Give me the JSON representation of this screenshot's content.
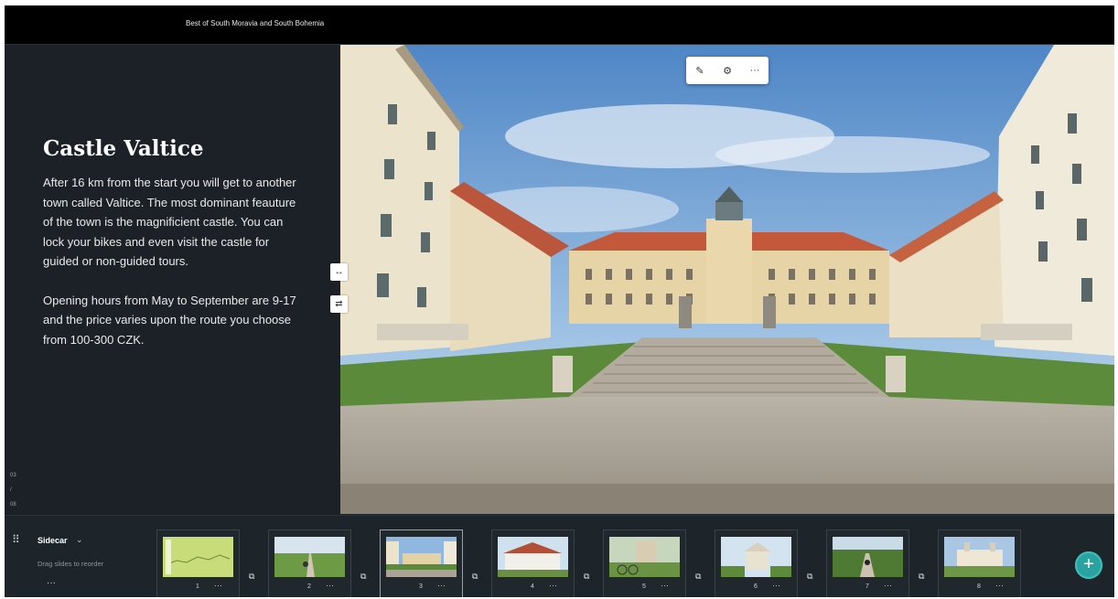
{
  "header": {
    "story_title": "Best of South Moravia and South Bohemia"
  },
  "slide": {
    "heading": "Castle Valtice",
    "paragraph1": "After 16 km from the start you will get to another town called Valtice. The most dominant feauture of the town is the magnificient castle. You can lock your bikes and even visit the castle for guided or non-guided tours.",
    "paragraph2": "Opening hours from May to September are 9-17 and the price varies upon the route you choose from 100-300 CZK.",
    "counter_current": "03",
    "counter_sep": "/",
    "counter_total": "08"
  },
  "side_buttons": {
    "swap_width_icon": "↔",
    "swap_sides_icon": "⇄"
  },
  "media_toolbar": {
    "edit_icon": "✎",
    "settings_icon": "⚙",
    "more_icon": "···"
  },
  "bottom_bar": {
    "label": "Sidecar",
    "chevron": "⌄",
    "hint": "Drag slides to reorder",
    "more": "···",
    "grip_icon": "⠿",
    "add_icon": "+",
    "duplicate_icon": "⧉",
    "slides": [
      {
        "number": "1",
        "more": "···"
      },
      {
        "number": "2",
        "more": "···"
      },
      {
        "number": "3",
        "more": "···"
      },
      {
        "number": "4",
        "more": "···"
      },
      {
        "number": "5",
        "more": "···"
      },
      {
        "number": "6",
        "more": "···"
      },
      {
        "number": "7",
        "more": "···"
      },
      {
        "number": "8",
        "more": "···"
      }
    ],
    "active_slide": "3"
  },
  "colors": {
    "accent": "#2aa3a0",
    "panel": "#1b2127",
    "topbar": "#000000"
  }
}
